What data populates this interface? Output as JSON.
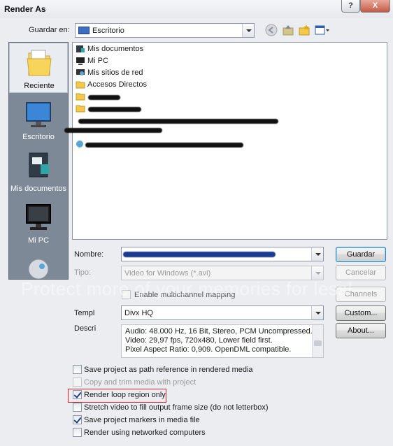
{
  "window": {
    "title": "Render As",
    "help_label": "?",
    "close_label": "X"
  },
  "location": {
    "label": "Guardar en:",
    "value": "Escritorio"
  },
  "places": [
    {
      "label": "Reciente"
    },
    {
      "label": "Escritorio"
    },
    {
      "label": "Mis documentos"
    },
    {
      "label": "Mi PC"
    }
  ],
  "files": [
    {
      "name": "Mis documentos"
    },
    {
      "name": "Mi PC"
    },
    {
      "name": "Mis sitios de red"
    },
    {
      "name": "Accesos Directos"
    }
  ],
  "form": {
    "nombre_label": "Nombre:",
    "tipo_label": "Tipo:",
    "tipo_value": "Video for Windows (*.avi)",
    "multichannel_label": "Enable multichannel mapping",
    "template_label": "Templ",
    "template_value": "Divx HQ",
    "desc_label": "Descri",
    "description_lines": [
      "Audio: 48.000 Hz, 16 Bit, Stereo, PCM Uncompressed.",
      "Video: 29,97 fps, 720x480, Lower field first.",
      "Pixel Aspect Ratio: 0,909. OpenDML compatible."
    ]
  },
  "buttons": {
    "save": "Guardar",
    "cancel": "Cancelar",
    "channels": "Channels",
    "custom": "Custom...",
    "about": "About..."
  },
  "options": [
    {
      "label": "Save project as path reference in rendered media",
      "checked": false,
      "enabled": true
    },
    {
      "label": "Copy and trim media with project",
      "checked": false,
      "enabled": false
    },
    {
      "label": "Render loop region only",
      "checked": true,
      "enabled": true
    },
    {
      "label": "Stretch video to fill output frame size (do not letterbox)",
      "checked": false,
      "enabled": true
    },
    {
      "label": "Save project markers in media file",
      "checked": true,
      "enabled": true
    },
    {
      "label": "Render using networked computers",
      "checked": false,
      "enabled": true
    }
  ],
  "watermark": "Protect more of your memories for less!",
  "colors": {
    "highlight": "#d9232b",
    "places_bg": "#7e8998"
  }
}
